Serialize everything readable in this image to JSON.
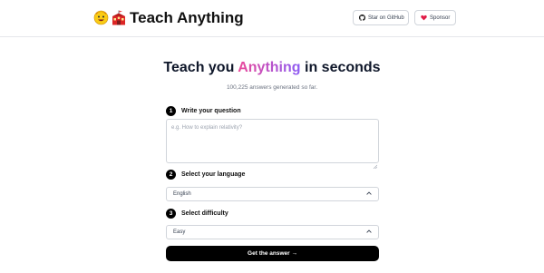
{
  "header": {
    "title": "Teach Anything",
    "logo_icons": [
      "grinning-face-icon",
      "school-icon"
    ],
    "github_button": {
      "label": "Star on GitHub",
      "icon": "github-icon"
    },
    "sponsor_button": {
      "label": "Sponsor",
      "icon": "heart-icon"
    }
  },
  "hero": {
    "headline_prefix": "Teach you",
    "headline_highlight": "Anything",
    "headline_suffix": "in seconds",
    "answer_count_text": "100,225 answers generated so far."
  },
  "form": {
    "question": {
      "step": "1",
      "label": "Write your question",
      "placeholder": "e.g. How to explain relativity?",
      "value": ""
    },
    "language": {
      "step": "2",
      "label": "Select your language",
      "value": "English"
    },
    "difficulty": {
      "step": "3",
      "label": "Select difficulty",
      "value": "Easy"
    },
    "submit_label": "Get the answer →"
  },
  "colors": {
    "gradient_start": "#ec4899",
    "gradient_end": "#8b5cf6",
    "sponsor_heart": "#e11d48",
    "primary_button": "#000000"
  }
}
